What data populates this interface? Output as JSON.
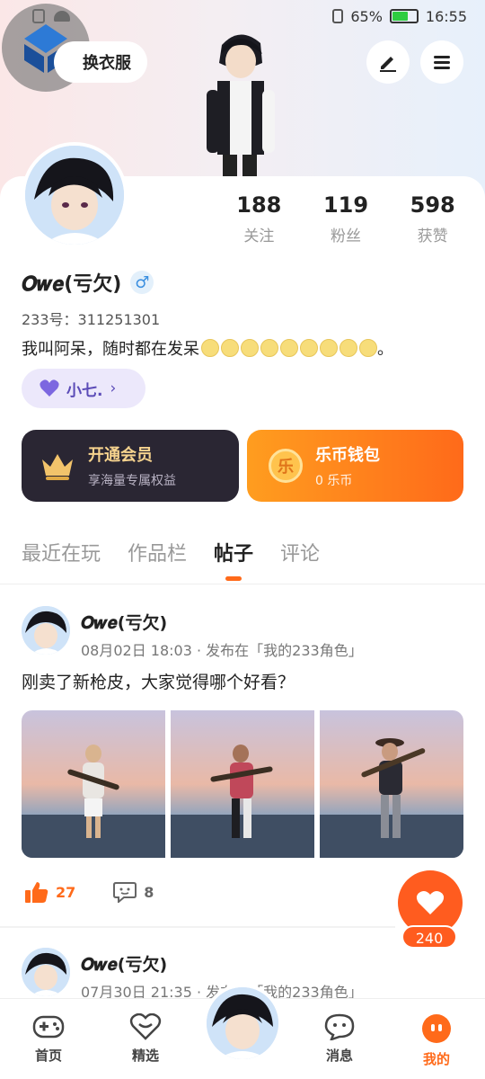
{
  "status_bar": {
    "battery": "65%",
    "battery_level": 0.65,
    "time": "16:55"
  },
  "header": {
    "dress_button": "换衣服"
  },
  "profile": {
    "stats": [
      {
        "value": "188",
        "label": "关注"
      },
      {
        "value": "119",
        "label": "粉丝"
      },
      {
        "value": "598",
        "label": "获赞"
      }
    ],
    "nickname": "𝑶𝒘𝒆(亏欠)",
    "gender": "♂",
    "uid": "233号：311251301",
    "bio": "我叫阿呆，随时都在发呆",
    "bio_end": "。",
    "tag": "小七."
  },
  "vip": {
    "title": "开通会员",
    "subtitle": "享海量专属权益"
  },
  "wallet": {
    "title": "乐币钱包",
    "subtitle": "0 乐币",
    "coin": "乐"
  },
  "tabs": [
    "最近在玩",
    "作品栏",
    "帖子",
    "评论"
  ],
  "posts": [
    {
      "author": "𝑶𝒘𝒆(亏欠)",
      "meta": "08月02日 18:03 · 发布在「我的233角色」",
      "text": "刚卖了新枪皮，大家觉得哪个好看？",
      "likes": "27",
      "comments": "8"
    },
    {
      "author": "𝑶𝒘𝒆(亏欠)",
      "meta": "07月30日 21:35 · 发布在「我的233角色」"
    }
  ],
  "like_fab": {
    "count": "240"
  },
  "bottom_nav": [
    {
      "label": "首页"
    },
    {
      "label": "精选"
    },
    {
      "label": "消息"
    },
    {
      "label": "我的"
    }
  ],
  "colors": {
    "accent": "#ff6a1a",
    "vip_bg": "#2a2633",
    "tag_text": "#5b4bb7"
  }
}
